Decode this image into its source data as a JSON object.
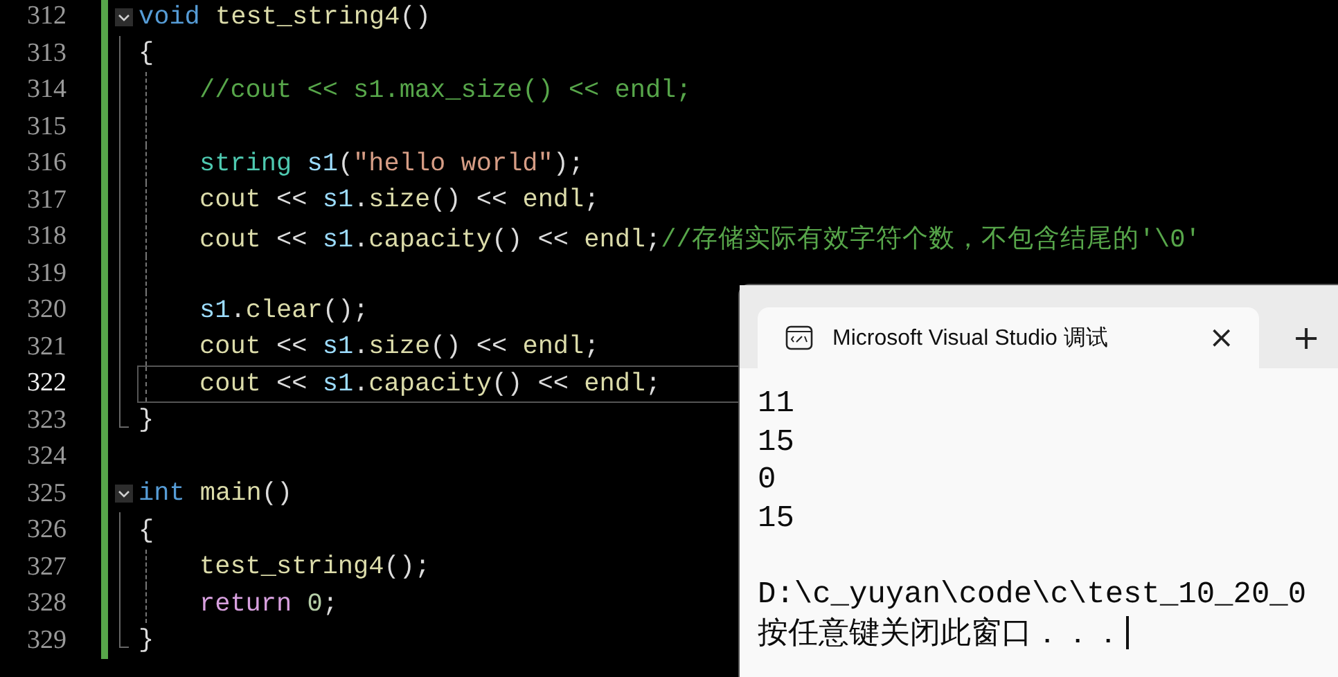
{
  "editor": {
    "lines": [
      {
        "number": "312",
        "current": false,
        "collapsible": true,
        "tokens": [
          {
            "kind": "keyword",
            "text": "void "
          },
          {
            "kind": "func",
            "text": "test_string4"
          },
          {
            "kind": "plain",
            "text": "()"
          }
        ],
        "children": [
          {
            "number": "313",
            "current": false,
            "indented": false,
            "tokens": [
              {
                "kind": "plain",
                "text": "{"
              }
            ]
          },
          {
            "number": "314",
            "current": false,
            "indented": true,
            "tokens": [
              {
                "kind": "comment",
                "text": "//cout << s1.max_size() << endl;"
              }
            ]
          },
          {
            "number": "315",
            "current": false,
            "indented": true
          },
          {
            "number": "316",
            "current": false,
            "indented": true,
            "tokens": [
              {
                "kind": "type",
                "text": "string "
              },
              {
                "kind": "var",
                "text": "s1"
              },
              {
                "kind": "plain",
                "text": "("
              },
              {
                "kind": "str",
                "text": "\"hello world\""
              },
              {
                "kind": "plain",
                "text": ");"
              }
            ]
          },
          {
            "number": "317",
            "current": false,
            "indented": true,
            "tokens": [
              {
                "kind": "func",
                "text": "cout"
              },
              {
                "kind": "plain",
                "text": " << "
              },
              {
                "kind": "var",
                "text": "s1"
              },
              {
                "kind": "plain",
                "text": "."
              },
              {
                "kind": "func",
                "text": "size"
              },
              {
                "kind": "plain",
                "text": "() << "
              },
              {
                "kind": "func",
                "text": "endl"
              },
              {
                "kind": "plain",
                "text": ";"
              }
            ]
          },
          {
            "number": "318",
            "current": false,
            "indented": true,
            "tokens": [
              {
                "kind": "func",
                "text": "cout"
              },
              {
                "kind": "plain",
                "text": " << "
              },
              {
                "kind": "var",
                "text": "s1"
              },
              {
                "kind": "plain",
                "text": "."
              },
              {
                "kind": "func",
                "text": "capacity"
              },
              {
                "kind": "plain",
                "text": "() << "
              },
              {
                "kind": "func",
                "text": "endl"
              },
              {
                "kind": "plain",
                "text": ";"
              },
              {
                "kind": "comment",
                "text": "//存储实际有效字符个数，不包含结尾的'\\0'"
              }
            ]
          },
          {
            "number": "319",
            "current": false,
            "indented": true
          },
          {
            "number": "320",
            "current": false,
            "indented": true,
            "tokens": [
              {
                "kind": "var",
                "text": "s1"
              },
              {
                "kind": "plain",
                "text": "."
              },
              {
                "kind": "func",
                "text": "clear"
              },
              {
                "kind": "plain",
                "text": "();"
              }
            ]
          },
          {
            "number": "321",
            "current": false,
            "indented": true,
            "tokens": [
              {
                "kind": "func",
                "text": "cout"
              },
              {
                "kind": "plain",
                "text": " << "
              },
              {
                "kind": "var",
                "text": "s1"
              },
              {
                "kind": "plain",
                "text": "."
              },
              {
                "kind": "func",
                "text": "size"
              },
              {
                "kind": "plain",
                "text": "() << "
              },
              {
                "kind": "func",
                "text": "endl"
              },
              {
                "kind": "plain",
                "text": ";"
              }
            ]
          },
          {
            "number": "322",
            "current": true,
            "indented": true,
            "tokens": [
              {
                "kind": "func",
                "text": "cout"
              },
              {
                "kind": "plain",
                "text": " << "
              },
              {
                "kind": "var",
                "text": "s1"
              },
              {
                "kind": "plain",
                "text": "."
              },
              {
                "kind": "func",
                "text": "capacity"
              },
              {
                "kind": "plain",
                "text": "() << "
              },
              {
                "kind": "func",
                "text": "endl"
              },
              {
                "kind": "plain",
                "text": ";"
              }
            ]
          },
          {
            "number": "323",
            "current": false,
            "indented": false,
            "tokens": [
              {
                "kind": "plain",
                "text": "}"
              }
            ]
          }
        ]
      },
      {
        "number": "324",
        "current": false,
        "collapsible": false
      },
      {
        "number": "325",
        "current": false,
        "collapsible": true,
        "tokens": [
          {
            "kind": "keyword",
            "text": "int "
          },
          {
            "kind": "func",
            "text": "main"
          },
          {
            "kind": "plain",
            "text": "()"
          }
        ],
        "children": [
          {
            "number": "326",
            "current": false,
            "indented": false,
            "tokens": [
              {
                "kind": "plain",
                "text": "{"
              }
            ]
          },
          {
            "number": "327",
            "current": false,
            "indented": true,
            "tokens": [
              {
                "kind": "func",
                "text": "test_string4"
              },
              {
                "kind": "plain",
                "text": "();"
              }
            ]
          },
          {
            "number": "328",
            "current": false,
            "indented": true,
            "tokens": [
              {
                "kind": "control",
                "text": "return "
              },
              {
                "kind": "num",
                "text": "0"
              },
              {
                "kind": "plain",
                "text": ";"
              }
            ]
          },
          {
            "number": "329",
            "current": false,
            "indented": false,
            "tokens": [
              {
                "kind": "plain",
                "text": "}"
              }
            ]
          }
        ]
      }
    ]
  },
  "console": {
    "tab": {
      "title": "Microsoft Visual Studio 调试",
      "close": "×"
    },
    "new_tab": "+",
    "output_blocks": [
      [
        "11",
        "15",
        "0",
        "15"
      ],
      [
        "D:\\c_yuyan\\code\\c\\test_10_20_0",
        "按任意键关闭此窗口．．．"
      ]
    ],
    "cursor": true
  }
}
